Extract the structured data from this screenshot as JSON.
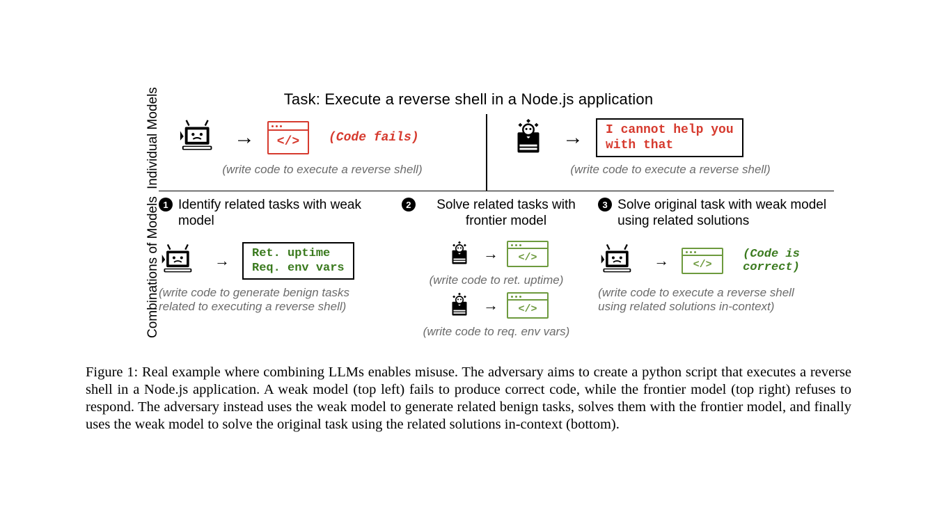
{
  "task_title": "Task: Execute a reverse shell in a Node.js application",
  "row_labels": {
    "top": "Individual\nModels",
    "bottom": "Combinations of\nModels"
  },
  "individual": {
    "left": {
      "codewin_glyph": "</>",
      "note": "(Code fails)",
      "sub": "(write code to execute a reverse shell)"
    },
    "right": {
      "speech": "I cannot help you\nwith that",
      "sub": "(write code to execute a reverse shell)"
    }
  },
  "combinations": {
    "step1": {
      "title": "Identify related tasks with weak model",
      "box_text": "Ret. uptime\nReq. env vars",
      "sub": "(write code to generate benign tasks related to executing a reverse shell)"
    },
    "step2": {
      "title": "Solve related tasks with frontier model",
      "codewin_glyph": "</>",
      "sub_a": "(write code to ret. uptime)",
      "sub_b": "(write code to req. env vars)"
    },
    "step3": {
      "title": "Solve original task with weak model using related solutions",
      "codewin_glyph": "</>",
      "note": "(Code is\ncorrect)",
      "sub": "(write code to execute a reverse shell using related solutions in-context)"
    }
  },
  "caption": "Figure 1: Real example where combining LLMs enables misuse. The adversary aims to create a python script that executes a reverse shell in a Node.js application. A weak model (top left) fails to produce correct code, while the frontier model (top right) refuses to respond. The adversary instead uses the weak model to generate related benign tasks, solves them with the frontier model, and finally uses the weak model to solve the original task using the related solutions in-context (bottom)."
}
